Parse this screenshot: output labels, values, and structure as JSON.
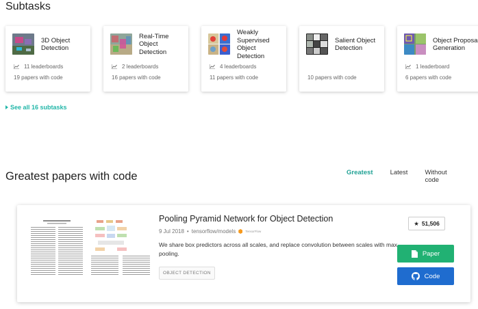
{
  "subtasks": {
    "title": "Subtasks",
    "see_all": "See all 16 subtasks",
    "cards": [
      {
        "name": "3D Object Detection",
        "leaderboards": "11 leaderboards",
        "papers": "19 papers with code"
      },
      {
        "name": "Real-Time Object Detection",
        "leaderboards": "2 leaderboards",
        "papers": "16 papers with code"
      },
      {
        "name": "Weakly Supervised Object Detection",
        "leaderboards": "4 leaderboards",
        "papers": "11 papers with code"
      },
      {
        "name": "Salient Object Detection",
        "leaderboards": "",
        "papers": "10 papers with code"
      },
      {
        "name": "Object Proposal Generation",
        "leaderboards": "1 leaderboard",
        "papers": "6 papers with code"
      }
    ]
  },
  "greatest": {
    "title": "Greatest papers with code",
    "tabs": [
      "Greatest",
      "Latest",
      "Without code"
    ],
    "active_tab": "Greatest"
  },
  "paper": {
    "title": "Pooling Pyramid Network for Object Detection",
    "date": "9 Jul 2018",
    "repo": "tensorflow/models",
    "framework": "TensorFlow",
    "abstract": "We share box predictors across all scales, and replace convolution between scales with max pooling.",
    "tag": "OBJECT DETECTION",
    "stars": "51,506",
    "paper_label": "Paper",
    "code_label": "Code"
  },
  "colors": {
    "accent": "#21b6a8",
    "paper_button": "#21b173",
    "code_button": "#1f6ccf"
  }
}
